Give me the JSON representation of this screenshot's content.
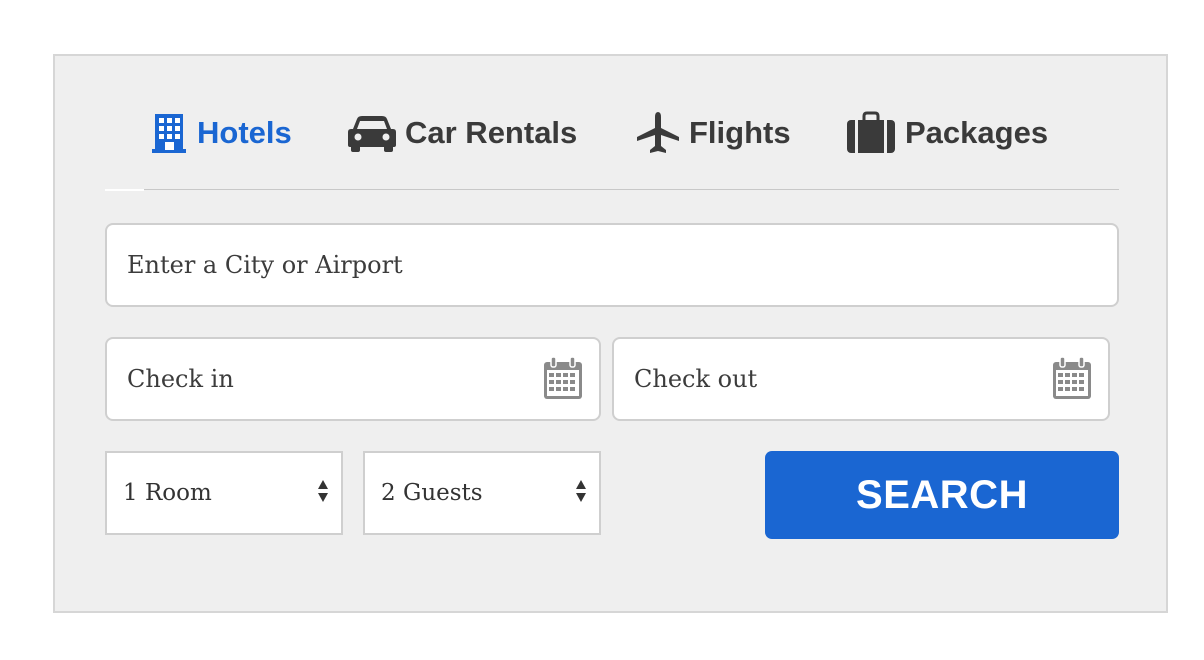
{
  "tabs": [
    {
      "label": "Hotels",
      "icon": "hotel-building-icon",
      "active": true
    },
    {
      "label": "Car Rentals",
      "icon": "car-icon",
      "active": false
    },
    {
      "label": "Flights",
      "icon": "airplane-icon",
      "active": false
    },
    {
      "label": "Packages",
      "icon": "suitcase-icon",
      "active": false
    }
  ],
  "destination": {
    "placeholder": "Enter a City or Airport",
    "value": ""
  },
  "check_in": {
    "placeholder": "Check in",
    "icon": "calendar-icon"
  },
  "check_out": {
    "placeholder": "Check out",
    "icon": "calendar-icon"
  },
  "rooms": {
    "selected": "1 Room"
  },
  "guests": {
    "selected": "2 Guests"
  },
  "search_button": {
    "label": "SEARCH"
  },
  "colors": {
    "accent": "#1a66d2",
    "panel_bg": "#efefef",
    "text": "#3a3a3a",
    "border": "#cfcfcf"
  }
}
